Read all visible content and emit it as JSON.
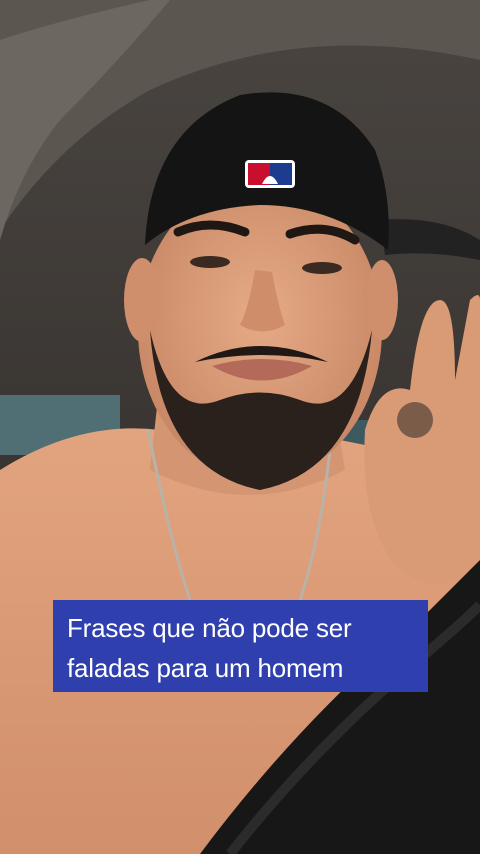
{
  "caption": {
    "line1": "Frases que não pode ser",
    "line2": "faladas para um homem",
    "background_color": "#2f3fae",
    "text_color": "#ffffff"
  },
  "scene": {
    "cap_logo_colors": [
      "#c8102e",
      "#ffffff",
      "#1d3c8f"
    ]
  }
}
